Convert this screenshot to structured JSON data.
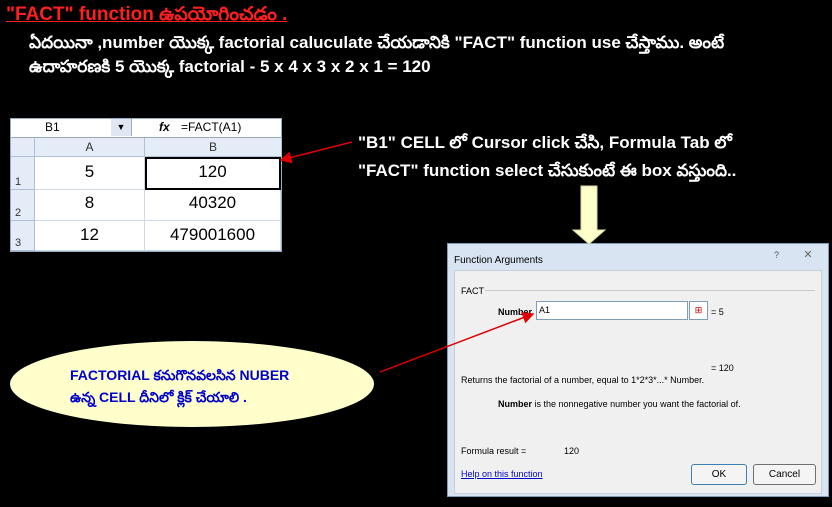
{
  "title": "\"FACT\"  function ఉపయోగించడం .",
  "description": {
    "line1": "ఏదయినా ,number యొక్క factorial caluculate చేయడానికి \"FACT\" function use చేస్తాము. అంటే",
    "line2": "ఉదాహరణకి   5 యొక్క factorial -  5 x 4 x 3 x 2 x 1 = 120"
  },
  "sheet": {
    "name_box": "B1",
    "fx_label": "fx",
    "formula": "=FACT(A1)",
    "columns": [
      "A",
      "B"
    ],
    "rows": [
      {
        "num": "1",
        "a": "5",
        "b": "120"
      },
      {
        "num": "2",
        "a": "8",
        "b": "40320"
      },
      {
        "num": "3",
        "a": "12",
        "b": "479001600"
      }
    ]
  },
  "info": {
    "line1": "\"B1\" CELL లో Cursor click చేసి, Formula Tab లో",
    "line2": "\"FACT\" function select చేసుకుంటే ఈ box వస్తుంది.."
  },
  "dialog": {
    "title": "Function Arguments",
    "help_q": "?",
    "close": "✕",
    "function_name": "FACT",
    "arg_label": "Number",
    "arg_value": "A1",
    "arg_result": "= 5",
    "result_eq": "= 120",
    "returns_desc": "Returns the factorial of a number, equal to 1*2*3*...* Number.",
    "arg_help_bold": "Number",
    "arg_help_text": " is the nonnegative number you want the factorial of.",
    "formula_result_label": "Formula result =",
    "formula_result_value": "120",
    "help_link": "Help on this function",
    "ok": "OK",
    "cancel": "Cancel"
  },
  "callout": {
    "line1": "FACTORIAL కనుగొనవలసిన NUBER",
    "line2": "ఉన్న  CELL  దీనిలో క్లిక్ చేయాలి ."
  },
  "colors": {
    "title": "#ff1f1f",
    "arrow": "#e00000",
    "callout_bg": "#ffffcc",
    "callout_text": "#0000cc",
    "down_arrow": "#ffffcc"
  }
}
